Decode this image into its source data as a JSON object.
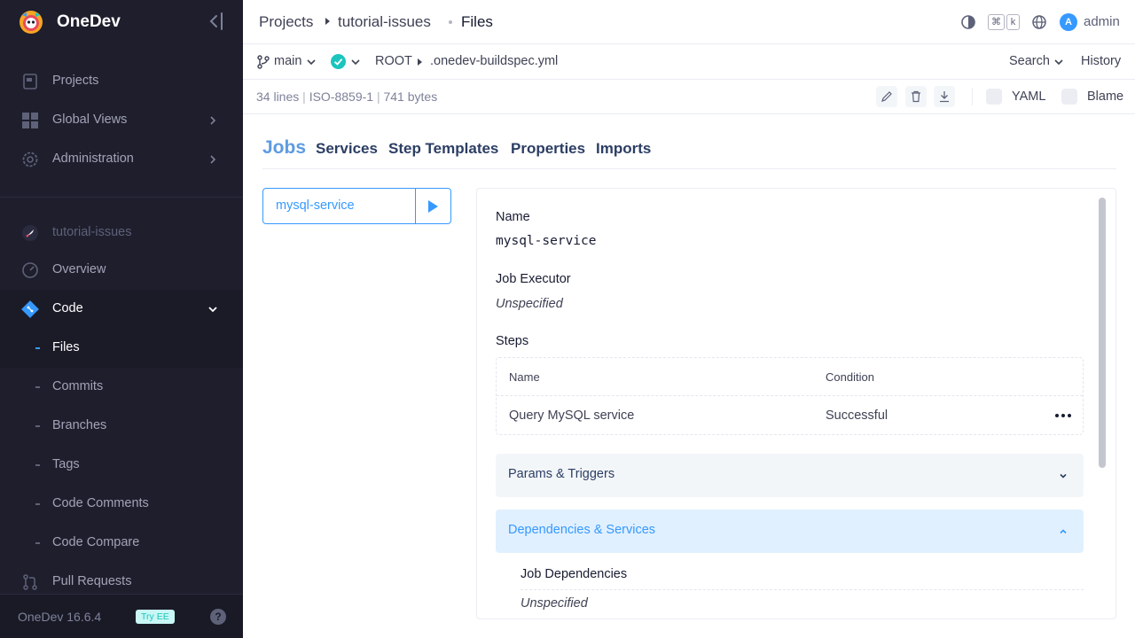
{
  "brand": {
    "name": "OneDev"
  },
  "sidebar": {
    "global_items": [
      {
        "label": "Projects",
        "icon": "projects-icon"
      },
      {
        "label": "Global Views",
        "icon": "grid-icon"
      },
      {
        "label": "Administration",
        "icon": "gear-icon"
      }
    ],
    "project_name": "tutorial-issues",
    "project_items": [
      {
        "label": "Overview"
      },
      {
        "label": "Code"
      }
    ],
    "code_sub_items": [
      {
        "label": "Files",
        "active": true
      },
      {
        "label": "Commits"
      },
      {
        "label": "Branches"
      },
      {
        "label": "Tags"
      },
      {
        "label": "Code Comments"
      },
      {
        "label": "Code Compare"
      }
    ],
    "pull_requests_label": "Pull Requests",
    "version": "OneDev 16.6.4",
    "try_ee": "Try EE",
    "help": "?"
  },
  "topbar": {
    "crumb_projects": "Projects",
    "crumb_project": "tutorial-issues",
    "crumb_page": "Files",
    "kbd_cmd": "⌘",
    "kbd_k": "k",
    "avatar_letter": "A",
    "user_name": "admin"
  },
  "branchbar": {
    "branch": "main",
    "path_root": "ROOT",
    "path_file": ".onedev-buildspec.yml",
    "search_label": "Search",
    "history_label": "History"
  },
  "infobar": {
    "lines": "34 lines",
    "encoding": "ISO-8859-1",
    "size": "741 bytes",
    "yaml_label": "YAML",
    "blame_label": "Blame"
  },
  "tabs": {
    "jobs": "Jobs",
    "services": "Services",
    "step_templates": "Step Templates",
    "properties": "Properties",
    "imports": "Imports"
  },
  "job": {
    "name_pill": "mysql-service",
    "name_label": "Name",
    "name_value": "mysql-service",
    "executor_label": "Job Executor",
    "executor_value": "Unspecified",
    "steps_label": "Steps",
    "steps_headers": {
      "name": "Name",
      "condition": "Condition"
    },
    "steps_rows": [
      {
        "name": "Query MySQL service",
        "condition": "Successful"
      }
    ],
    "params_triggers": "Params & Triggers",
    "deps_services": "Dependencies & Services",
    "job_deps_label": "Job Dependencies",
    "job_deps_value": "Unspecified"
  },
  "colors": {
    "accent": "#3699ff",
    "sidebar_bg": "#1e1e2d",
    "success": "#1bc5bd"
  }
}
